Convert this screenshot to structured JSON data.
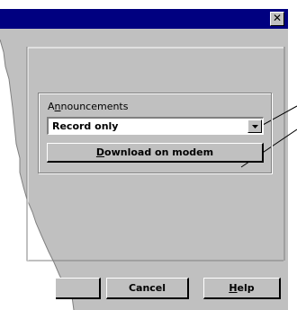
{
  "dialog": {
    "close_symbol": "✕"
  },
  "announcements": {
    "group_label_mnemonic": "n",
    "group_label_prefix": "A",
    "group_label_suffix": "nouncements",
    "selected_value": "Record only",
    "download_mnemonic": "D",
    "download_rest": "ownload on modem"
  },
  "buttons": {
    "ok_label": "",
    "cancel_label": "Cancel",
    "help_mnemonic": "H",
    "help_rest": "elp"
  },
  "colors": {
    "titlebar": "#000080",
    "face": "#c0c0c0",
    "shadow": "#808080",
    "highlight": "#ffffff"
  }
}
